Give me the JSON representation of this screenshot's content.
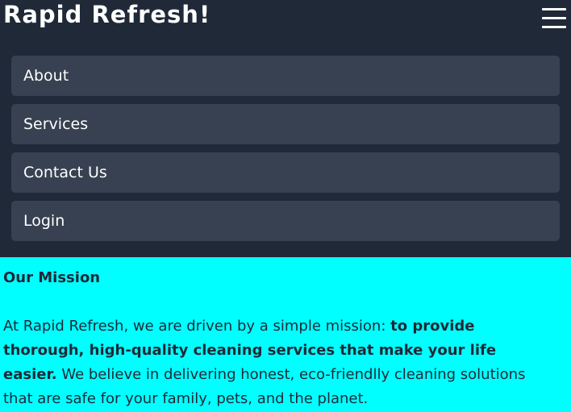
{
  "header": {
    "brand": "Rapid Refresh!",
    "menu_icon": "hamburger-menu-icon"
  },
  "nav": {
    "items": [
      {
        "label": "About"
      },
      {
        "label": "Services"
      },
      {
        "label": "Contact Us"
      },
      {
        "label": "Login"
      }
    ]
  },
  "mission": {
    "title": "Our Mission",
    "text_intro": "At Rapid Refresh, we are driven by a simple mission: ",
    "text_bold": "to provide thorough, high-quality cleaning services that make your life easier.",
    "text_rest": " We believe in delivering honest, eco-friendlly cleaning solutions that are safe for your family, pets, and the planet."
  },
  "colors": {
    "header_bg": "#1f2937",
    "nav_item_bg": "#374151",
    "content_bg": "#00ffff",
    "content_text": "#1f2937"
  }
}
